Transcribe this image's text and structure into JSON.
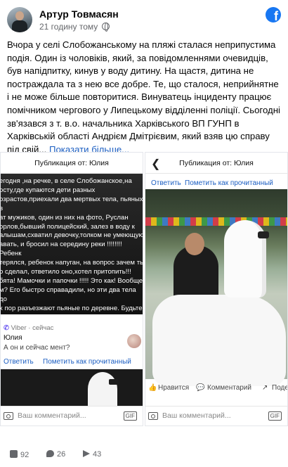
{
  "post": {
    "author": "Артур Товмасян",
    "time": "21 годину тому",
    "text": "Вчора у селі Слобожанському на пляжі сталася неприпустима подія. Один із чоловіків, який, за повідомленнями очевидців, був напідпитку, кинув у воду дитину. На щастя, дитина не постраждала та з нею все добре. Те, що сталося, неприйнятне і не може більше повторитися. Винуватець інциденту працює помічником чергового у Липецькому відділенні поліції. Сьогодні зв'язався з т. в.о. начальника Харківського ВП ГУНП в Харківській області Андрієм Дмітрієвим, який взяв цю справу під свій... ",
    "see_more": "Показати більше..."
  },
  "left_screenshot": {
    "title": "Публикация от: Юлия",
    "message": "егодня ,на речке, в селе Слобожанское,на\nосту,где купаются дети разных\nозрастов,приехали два мертвых тела, пьяных в\nат мужиков, один из них на фото, Руслан\nорлов,бывший полицейский, залез в воду к\nалышам,схватил девочку,толком не умеющую\nавать, и бросил на середину реки !!!!!!!! Ребенк\nтерялся, ребенок напуган, на вопрос зачем ты\nо сделал, ответило оно,хотел притопить!!!\nбята! Мамочки и папочки !!!!! Это как! Вообще\nм? Его быстро справадили, но эти два тела до\nх пор разъезжают пьяные по деревне. Будьте\nимательны! Берегите своих детей. Помогите\nспространить! Пусть люди знают наших героев",
    "viber_label": "Viber",
    "viber_time": "· сейчас",
    "sender": "Юлия",
    "message_preview": "А он и сейчас мент?",
    "reply_label": "Ответить",
    "mark_read_label": "Пометить как прочитанный",
    "comment_placeholder": "Ваш комментарий...",
    "gif_label": "GIF"
  },
  "right_screenshot": {
    "title": "Публикация от: Юлия",
    "reply_label": "Ответить",
    "mark_read_label": "Пометить как прочитанный",
    "like_label": "Нравится",
    "comment_label": "Комментарий",
    "share_label": "Поде",
    "comment_placeholder": "Ваш комментарий...",
    "gif_label": "GIF"
  },
  "stats": {
    "likes": "92",
    "comments": "26",
    "shares": "43"
  },
  "colors": {
    "link": "#1d5fc2",
    "facebook_blue": "#1877f2",
    "meta_text": "#65676b"
  }
}
